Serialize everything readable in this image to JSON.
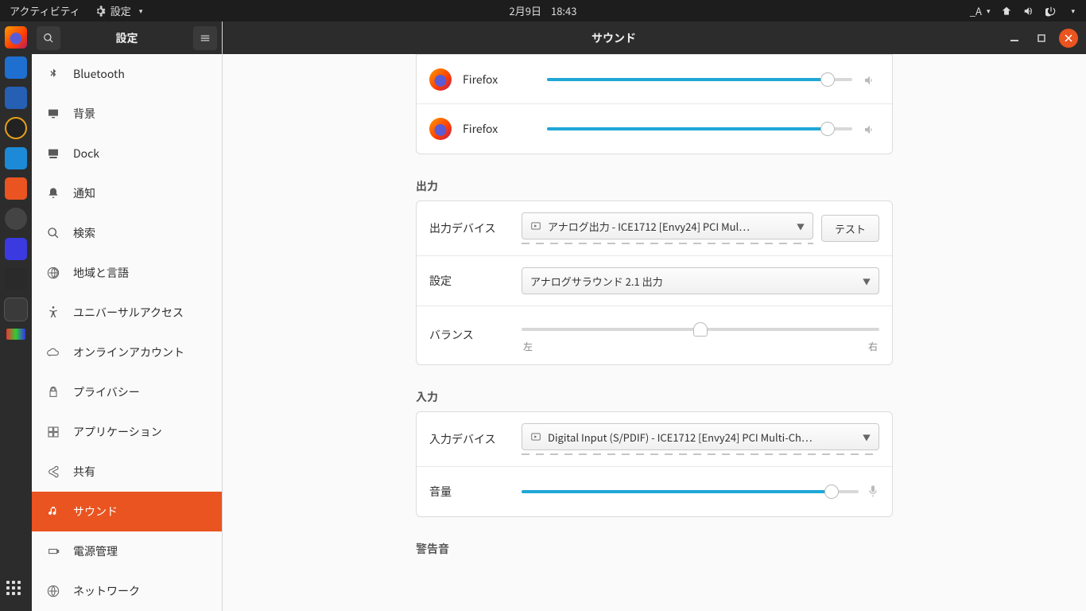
{
  "topbar": {
    "activities": "アクティビティ",
    "app_menu": "設定",
    "date": "2月9日",
    "time": "18:43",
    "ime": "_A"
  },
  "window": {
    "sidebar_title": "設定",
    "content_title": "サウンド"
  },
  "sidebar": {
    "items": [
      {
        "id": "bluetooth",
        "label": "Bluetooth"
      },
      {
        "id": "background",
        "label": "背景"
      },
      {
        "id": "dock",
        "label": "Dock"
      },
      {
        "id": "notifications",
        "label": "通知"
      },
      {
        "id": "search",
        "label": "検索"
      },
      {
        "id": "region",
        "label": "地域と言語"
      },
      {
        "id": "accessibility",
        "label": "ユニバーサルアクセス"
      },
      {
        "id": "online",
        "label": "オンラインアカウント"
      },
      {
        "id": "privacy",
        "label": "プライバシー"
      },
      {
        "id": "applications",
        "label": "アプリケーション"
      },
      {
        "id": "sharing",
        "label": "共有"
      },
      {
        "id": "sound",
        "label": "サウンド"
      },
      {
        "id": "power",
        "label": "電源管理"
      },
      {
        "id": "network",
        "label": "ネットワーク"
      }
    ]
  },
  "apps": [
    {
      "name": "Firefox",
      "volume": 92
    },
    {
      "name": "Firefox",
      "volume": 92
    }
  ],
  "output": {
    "section": "出力",
    "device_label": "出力デバイス",
    "device_value": "アナログ出力 - ICE1712 [Envy24] PCI Mul…",
    "test_button": "テスト",
    "config_label": "設定",
    "config_value": "アナログサラウンド 2.1 出力",
    "balance_label": "バランス",
    "balance_value": 50,
    "balance_left": "左",
    "balance_right": "右"
  },
  "input": {
    "section": "入力",
    "device_label": "入力デバイス",
    "device_value": "Digital Input (S/PDIF) - ICE1712 [Envy24] PCI Multi-Ch…",
    "volume_label": "音量",
    "volume_value": 92
  },
  "alert": {
    "section": "警告音"
  }
}
